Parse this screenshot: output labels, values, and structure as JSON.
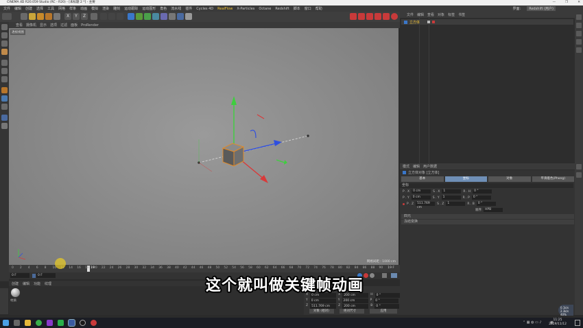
{
  "window": {
    "title": "CINEMA 4D R20.059 Studio (RC - R20) - [未标题 2 *] - 主要",
    "controls": [
      "—",
      "❐",
      "✕"
    ]
  },
  "menubar": {
    "items": [
      "文件",
      "编辑",
      "创建",
      "选择",
      "工具",
      "网格",
      "样条",
      "动画",
      "模拟",
      "渲染",
      "雕刻",
      "运动跟踪",
      "运动图形",
      "角色",
      "流水线",
      "插件",
      "Cycles 4D",
      "RealFlow",
      "X-Particles",
      "Octane",
      "Redshift",
      "脚本",
      "窗口",
      "帮助"
    ],
    "right_items": [
      "界面:",
      "Redshift (用户)"
    ]
  },
  "toolbar": {
    "axis_labels": [
      "X",
      "Y",
      "Z"
    ]
  },
  "viewport": {
    "menu": [
      "查看",
      "摄像机",
      "显示",
      "选项",
      "过滤",
      "面板",
      "ProRender"
    ],
    "label": "透视视图",
    "grid_info": "网格间距 : 1000 cm"
  },
  "timeline": {
    "ticks": [
      "0",
      "2",
      "4",
      "6",
      "8",
      "10",
      "12",
      "14",
      "16",
      "18",
      "20",
      "22",
      "24",
      "26",
      "28",
      "30",
      "32",
      "34",
      "36",
      "38",
      "40",
      "42",
      "44",
      "46",
      "48",
      "50",
      "52",
      "54",
      "56",
      "58",
      "60",
      "62",
      "64",
      "66",
      "68",
      "70",
      "72",
      "74",
      "76",
      "78",
      "80",
      "82",
      "84",
      "86",
      "88",
      "90"
    ],
    "current_frame": "19",
    "end_frame": "19 F",
    "start_field": "0 F",
    "end_field": "0 F"
  },
  "material": {
    "menu": [
      "创建",
      "编辑",
      "功能",
      "纹理"
    ],
    "name": "材质"
  },
  "coordinates": {
    "pos_x": "0 cm",
    "pos_y": "0 cm",
    "pos_z": "511.769 cm",
    "size_x": "200 cm",
    "size_y": "200 cm",
    "size_z": "200 cm",
    "rot_h": "0 °",
    "rot_p": "0 °",
    "rot_b": "0 °",
    "mode_left": "对象 (相对)",
    "mode_right": "绝对尺寸",
    "apply": "应用"
  },
  "object_manager": {
    "menu": [
      "文件",
      "编辑",
      "查看",
      "对象",
      "标签",
      "书签"
    ],
    "object_name": "立方体"
  },
  "attributes": {
    "menu": [
      "模式",
      "编辑",
      "用户数据"
    ],
    "title": "立方体对象 [立方体]",
    "tabs": [
      "基本",
      "坐标",
      "对象",
      "平滑着色(Phong)"
    ],
    "active_tab": "坐标",
    "section": "坐标",
    "rows": [
      {
        "p_axis": "P . X",
        "p_val": "0 cm",
        "s_axis": "S . X",
        "s_val": "1",
        "r_axis": "R . H",
        "r_val": "0 °"
      },
      {
        "p_axis": "P . Y",
        "p_val": "0 cm",
        "s_axis": "S . Y",
        "s_val": "1",
        "r_axis": "R . P",
        "r_val": "0 °"
      },
      {
        "p_axis": "P . Z",
        "p_val": "511.769 cm",
        "s_axis": "S . Z",
        "s_val": "1",
        "r_axis": "R . B",
        "r_val": "0 °"
      }
    ],
    "order_label": "顺序",
    "order_value": "HPB",
    "collapsibles": [
      "四元",
      "冻结变换"
    ]
  },
  "subtitle": "这个就叫做关键帧动画",
  "taskbar": {
    "time": "11:25",
    "date": "2019/11/12",
    "net_speed_up": "0.1k/s",
    "net_speed_down": "2.3k/s",
    "net_percent": "40%",
    "lang": "英"
  },
  "colors": {
    "accent_blue": "#6f8fb6",
    "axis_green": "#3ecf3e",
    "axis_red": "#d83a3a",
    "axis_blue": "#2f4fe0",
    "cube_orange": "#e08a2a"
  }
}
